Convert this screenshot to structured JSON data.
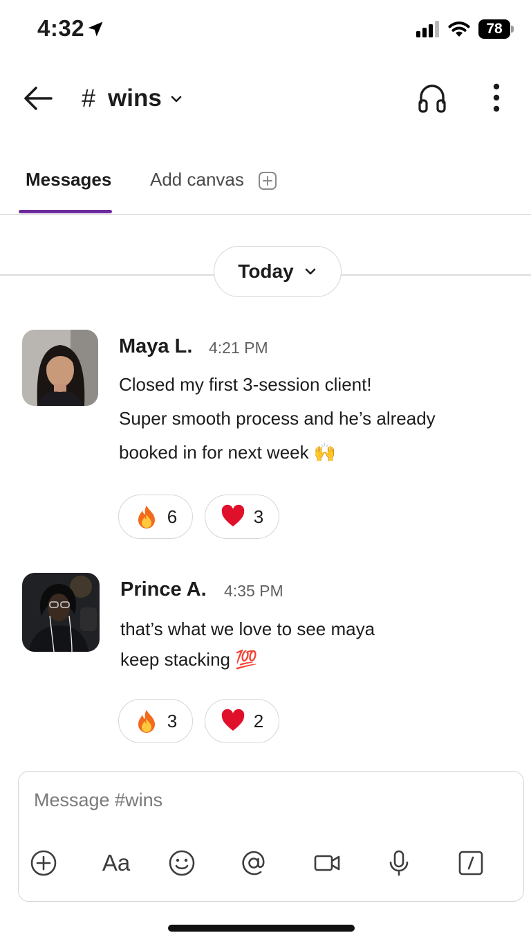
{
  "status_bar": {
    "time": "4:32",
    "battery": "78"
  },
  "header": {
    "channel_prefix": "#",
    "channel_name": "wins"
  },
  "tabs": [
    {
      "label": "Messages",
      "active": true
    },
    {
      "label": "Add canvas",
      "active": false
    }
  ],
  "date_divider": "Today",
  "messages": [
    {
      "sender": "Maya L.",
      "time": "4:21 PM",
      "lines": [
        "Closed my first 3-session client!",
        "Super smooth process and he’s already",
        "booked in for next week 🙌"
      ],
      "reactions": [
        {
          "emoji": "fire",
          "count": "6"
        },
        {
          "emoji": "red-heart",
          "count": "3"
        }
      ]
    },
    {
      "sender": "Prince A.",
      "time": "4:35 PM",
      "lines": [
        "that’s what we love to see maya",
        "keep stacking 💯"
      ],
      "reactions": [
        {
          "emoji": "fire",
          "count": "3"
        },
        {
          "emoji": "red-heart",
          "count": "2"
        }
      ]
    }
  ],
  "composer": {
    "placeholder": "Message #wins",
    "format_label": "Aa"
  },
  "colors": {
    "tab_accent": "#6f2b9e",
    "reaction_heart": "#e0102a",
    "fire": "#f26b1d"
  }
}
